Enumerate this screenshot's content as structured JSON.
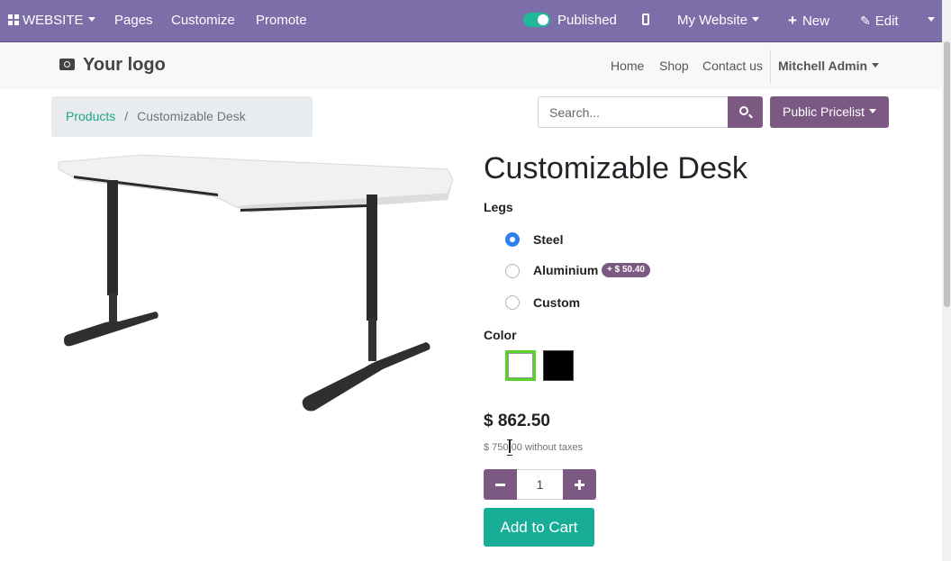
{
  "topbar": {
    "website_menu": "WEBSITE",
    "pages": "Pages",
    "customize": "Customize",
    "promote": "Promote",
    "published": "Published",
    "my_website": "My Website",
    "new": "New",
    "edit": "Edit"
  },
  "header": {
    "logo": "Your logo",
    "nav": [
      "Home",
      "Shop",
      "Contact us"
    ],
    "user": "Mitchell Admin"
  },
  "breadcrumb": {
    "parent": "Products",
    "separator": "/",
    "current": "Customizable Desk"
  },
  "search": {
    "placeholder": "Search..."
  },
  "pricelist": "Public Pricelist",
  "product": {
    "title": "Customizable Desk",
    "legs_label": "Legs",
    "legs_options": [
      {
        "label": "Steel",
        "selected": true
      },
      {
        "label": "Aluminium",
        "extra": "+ $ 50.40",
        "selected": false
      },
      {
        "label": "Custom",
        "selected": false
      }
    ],
    "color_label": "Color",
    "colors": [
      {
        "name": "white",
        "hex": "#ffffff",
        "selected": true
      },
      {
        "name": "black",
        "hex": "#000000",
        "selected": false
      }
    ],
    "price": "$ 862.50",
    "price_without_taxes": "$ 750.00 without taxes",
    "quantity": "1",
    "add_to_cart": "Add to Cart"
  },
  "colors": {
    "topbar": "#7c6ea9",
    "primary": "#7c5983",
    "accent": "#18ad96",
    "toggle_on": "#21b799"
  }
}
